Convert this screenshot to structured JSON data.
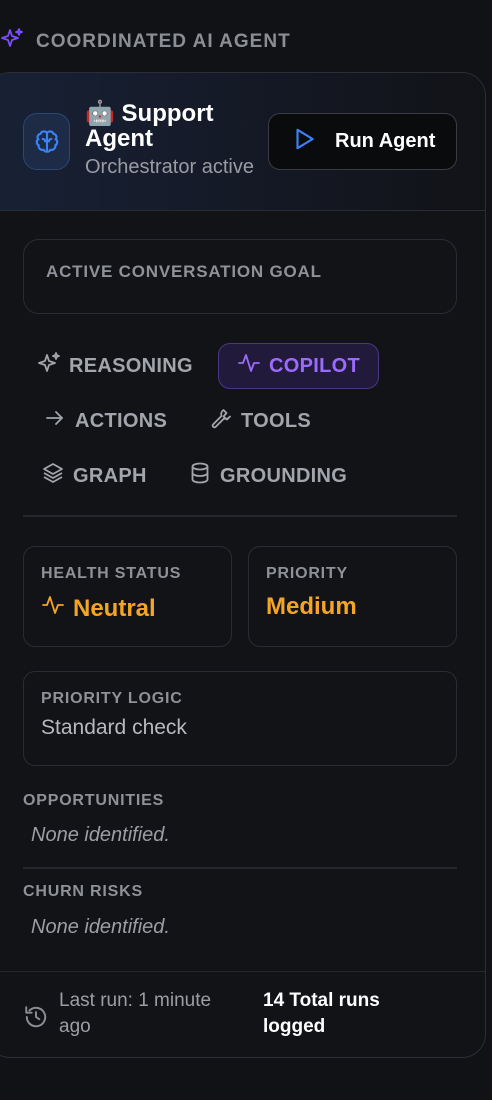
{
  "section": {
    "title": "COORDINATED AI AGENT",
    "icon": "sparkles-icon"
  },
  "agent": {
    "name": "🤖 Support Agent",
    "status": "Orchestrator active",
    "avatar_icon": "brain-icon"
  },
  "run_button": {
    "label": "Run Agent",
    "icon": "play-icon"
  },
  "goal": {
    "label": "ACTIVE CONVERSATION GOAL",
    "value": ""
  },
  "tabs": [
    {
      "label": "REASONING",
      "icon": "sparkles-icon",
      "active": false
    },
    {
      "label": "COPILOT",
      "icon": "activity-icon",
      "active": true
    },
    {
      "label": "ACTIONS",
      "icon": "arrow-right-icon",
      "active": false
    },
    {
      "label": "TOOLS",
      "icon": "wrench-icon",
      "active": false
    },
    {
      "label": "GRAPH",
      "icon": "layers-icon",
      "active": false
    },
    {
      "label": "GROUNDING",
      "icon": "database-icon",
      "active": false
    }
  ],
  "health": {
    "label": "HEALTH STATUS",
    "value": "Neutral",
    "icon": "activity-icon"
  },
  "priority": {
    "label": "PRIORITY",
    "value": "Medium"
  },
  "priority_logic": {
    "label": "PRIORITY LOGIC",
    "value": "Standard check"
  },
  "opportunities": {
    "label": "OPPORTUNITIES",
    "empty_text": "None identified."
  },
  "churn_risks": {
    "label": "CHURN RISKS",
    "empty_text": "None identified."
  },
  "footer": {
    "last_run": "Last run: 1 minute ago",
    "total_runs": "14 Total runs logged",
    "icon": "history-icon"
  },
  "colors": {
    "accent_purple": "#9b6bff",
    "accent_blue": "#3b82f6",
    "warning_orange": "#f5a524",
    "background": "#111216"
  }
}
